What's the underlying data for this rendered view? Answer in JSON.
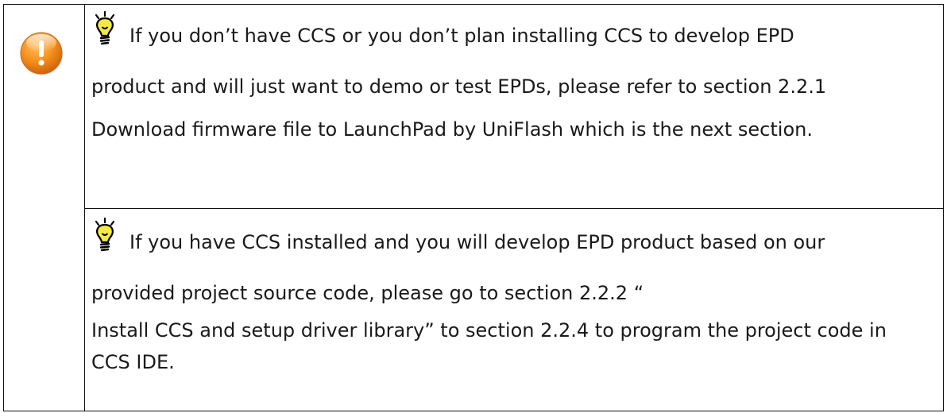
{
  "notes": [
    {
      "icon": "lightbulb-icon",
      "lines": [
        "If you don’t have CCS or you don’t plan installing CCS to develop EPD",
        "product and will just want to demo or test EPDs, please refer to section 2.2.1",
        "Download firmware file to LaunchPad by UniFlash which is the next section."
      ]
    },
    {
      "icon": "lightbulb-icon",
      "lines": [
        "If you have CCS installed and you will develop EPD product based on our",
        "provided project source code, please go to section 2.2.2 “",
        "Install CCS and setup driver library” to section 2.2.4 to program the project code in",
        "CCS IDE."
      ]
    }
  ],
  "sidebar_icon": "warning-exclamation-icon",
  "colors": {
    "warning": "#f08a1e",
    "border": "#111111"
  }
}
